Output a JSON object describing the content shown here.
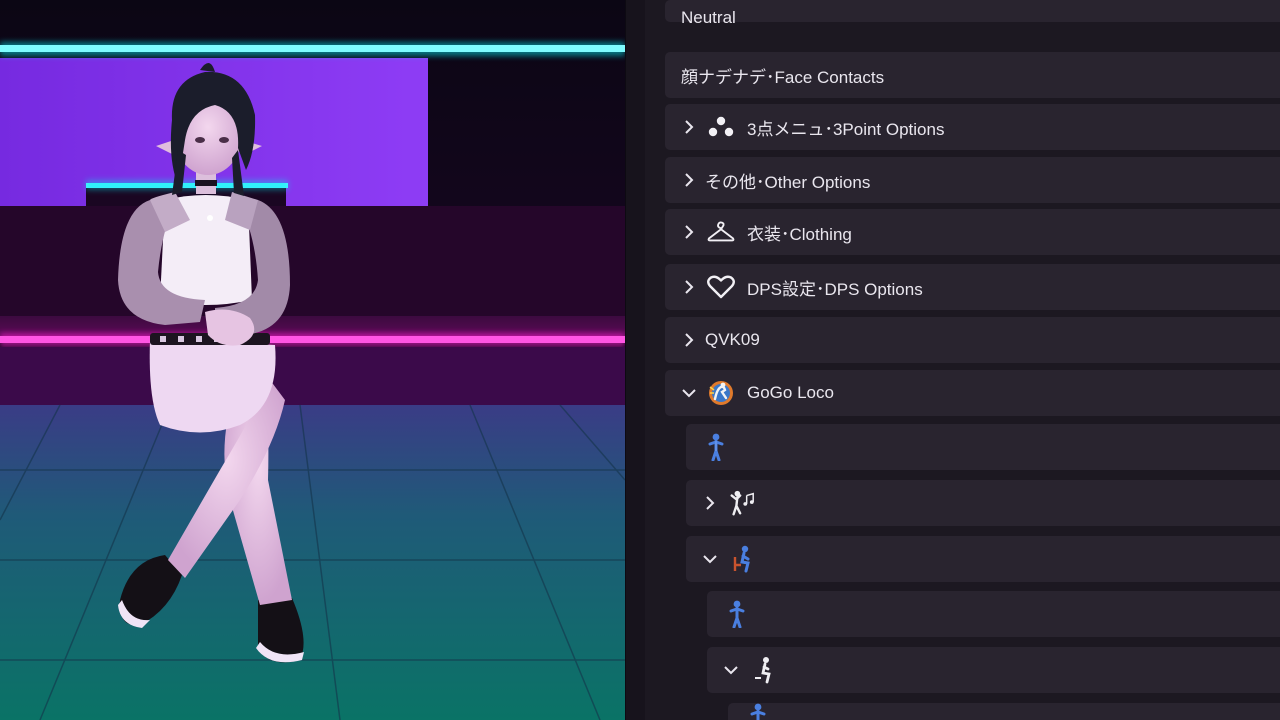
{
  "viewport": {
    "scene": "3D avatar seated with legs crossed in a neon-lit room"
  },
  "menu": {
    "items": [
      {
        "label": "Neutral",
        "expandable": false,
        "icon": ""
      },
      {
        "label": "顔ナデナデ･Face Contacts",
        "expandable": false,
        "icon": ""
      },
      {
        "label": "3点メニュ･3Point Options",
        "expandable": true,
        "expanded": false,
        "icon": "three-dots-icon"
      },
      {
        "label": "その他･Other Options",
        "expandable": true,
        "expanded": false,
        "icon": ""
      },
      {
        "label": "衣装･Clothing",
        "expandable": true,
        "expanded": false,
        "icon": "hanger-icon"
      },
      {
        "label": "DPS設定･DPS Options",
        "expandable": true,
        "expanded": false,
        "icon": "heart-icon"
      },
      {
        "label": "QVK09",
        "expandable": true,
        "expanded": false,
        "icon": ""
      },
      {
        "label": "GoGo Loco",
        "expandable": true,
        "expanded": true,
        "icon": "gogo-loco-icon"
      },
      {
        "label": "",
        "expandable": false,
        "icon": "standing-figure-icon"
      },
      {
        "label": "",
        "expandable": true,
        "expanded": false,
        "icon": "dance-music-icon"
      },
      {
        "label": "",
        "expandable": true,
        "expanded": true,
        "icon": "sitting-figure-icon"
      },
      {
        "label": "",
        "expandable": false,
        "icon": "standing-figure-icon"
      },
      {
        "label": "",
        "expandable": true,
        "expanded": true,
        "icon": "seated-pose-icon"
      },
      {
        "label": "",
        "expandable": false,
        "icon": "standing-figure-icon"
      }
    ]
  },
  "colors": {
    "panel_bg": "#1c1821",
    "row_bg": "#29242f",
    "text": "#e9e6ee",
    "neon_cyan": "#00f0f0",
    "neon_magenta": "#ff1bd0",
    "neon_purple": "#8a2be2",
    "figure_blue": "#4a7fe0"
  }
}
